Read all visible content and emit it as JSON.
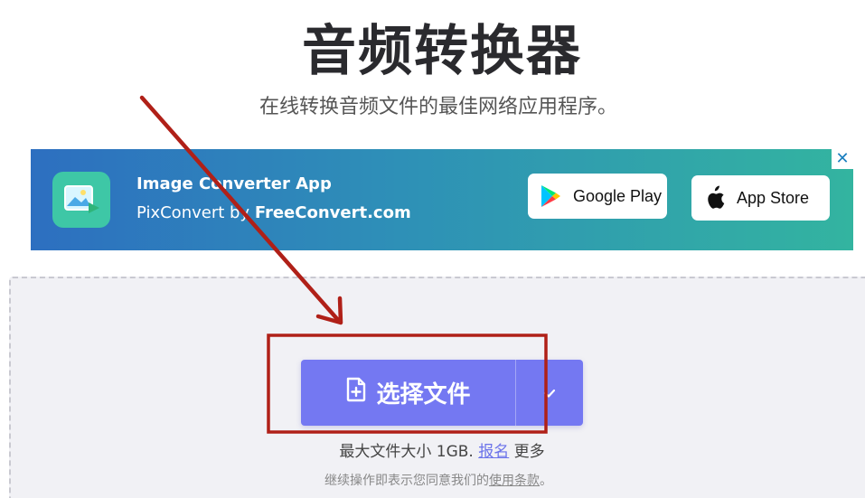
{
  "header": {
    "title": "音频转换器",
    "subtitle": "在线转换音频文件的最佳网络应用程序。"
  },
  "ad": {
    "app_name": "Image Converter App",
    "tagline_prefix": "PixConvert by ",
    "tagline_brand": "FreeConvert.com",
    "google_play_label": "Google Play",
    "app_store_label": "App Store",
    "close_glyph": "✕"
  },
  "upload": {
    "choose_label": "选择文件",
    "limit_prefix": "最大文件大小 1GB. ",
    "signup_link": "报名",
    "more_label": " 更多",
    "terms_prefix": "继续操作即表示您同意我们的",
    "terms_link": "使用条款",
    "terms_suffix": "。"
  },
  "colors": {
    "accent": "#7478f2",
    "annotation": "#b02018",
    "ad_gradient_start": "#2d6fc0",
    "ad_gradient_end": "#33b4a0"
  },
  "icons": {
    "file_plus": "file-plus-icon",
    "chevron": "chevron-down-icon",
    "google_play": "google-play-icon",
    "apple": "apple-icon",
    "close": "close-icon"
  }
}
